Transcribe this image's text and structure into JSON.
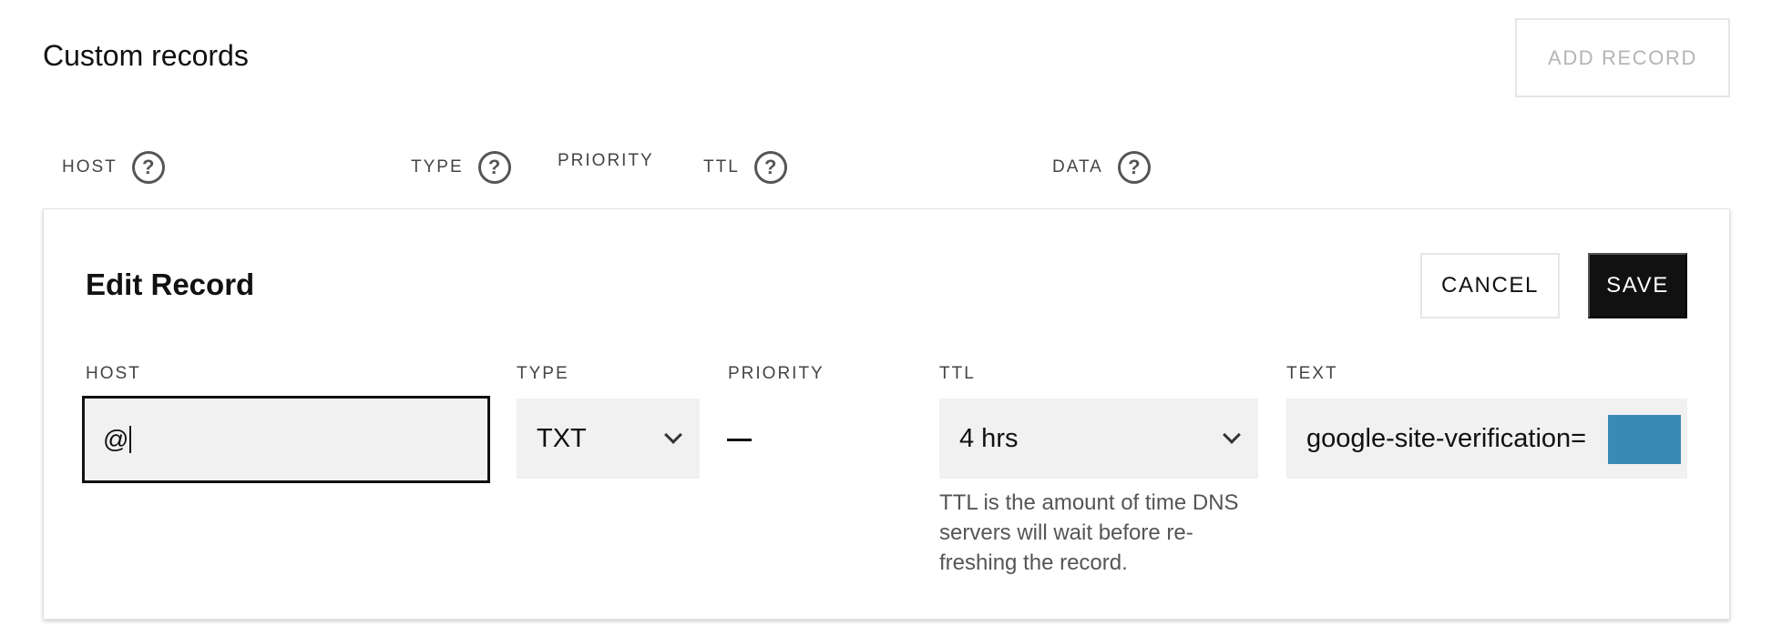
{
  "section": {
    "title": "Custom records",
    "add_record_label": "ADD RECORD"
  },
  "columns": {
    "host": "HOST",
    "type": "TYPE",
    "priority": "PRIORITY",
    "ttl": "TTL",
    "data": "DATA",
    "help_glyph": "?"
  },
  "edit_record": {
    "title": "Edit Record",
    "cancel_label": "CANCEL",
    "save_label": "SAVE",
    "fields": {
      "host_label": "HOST",
      "host_value": "@",
      "type_label": "TYPE",
      "type_value": "TXT",
      "priority_label": "PRIORITY",
      "priority_value": "—",
      "ttl_label": "TTL",
      "ttl_value": "4 hrs",
      "ttl_help": "TTL is the amount of time DNS servers will wait before re-freshing the record.",
      "text_label": "TEXT",
      "text_value": "google-site-verification="
    }
  },
  "colors": {
    "primary_button": "#111111",
    "input_background": "#f1f1f1",
    "redaction": "#3b8ab5",
    "disabled_text": "#b4b4b4"
  },
  "icons": {
    "help": "question-circle-icon",
    "dropdown": "chevron-down-icon"
  }
}
